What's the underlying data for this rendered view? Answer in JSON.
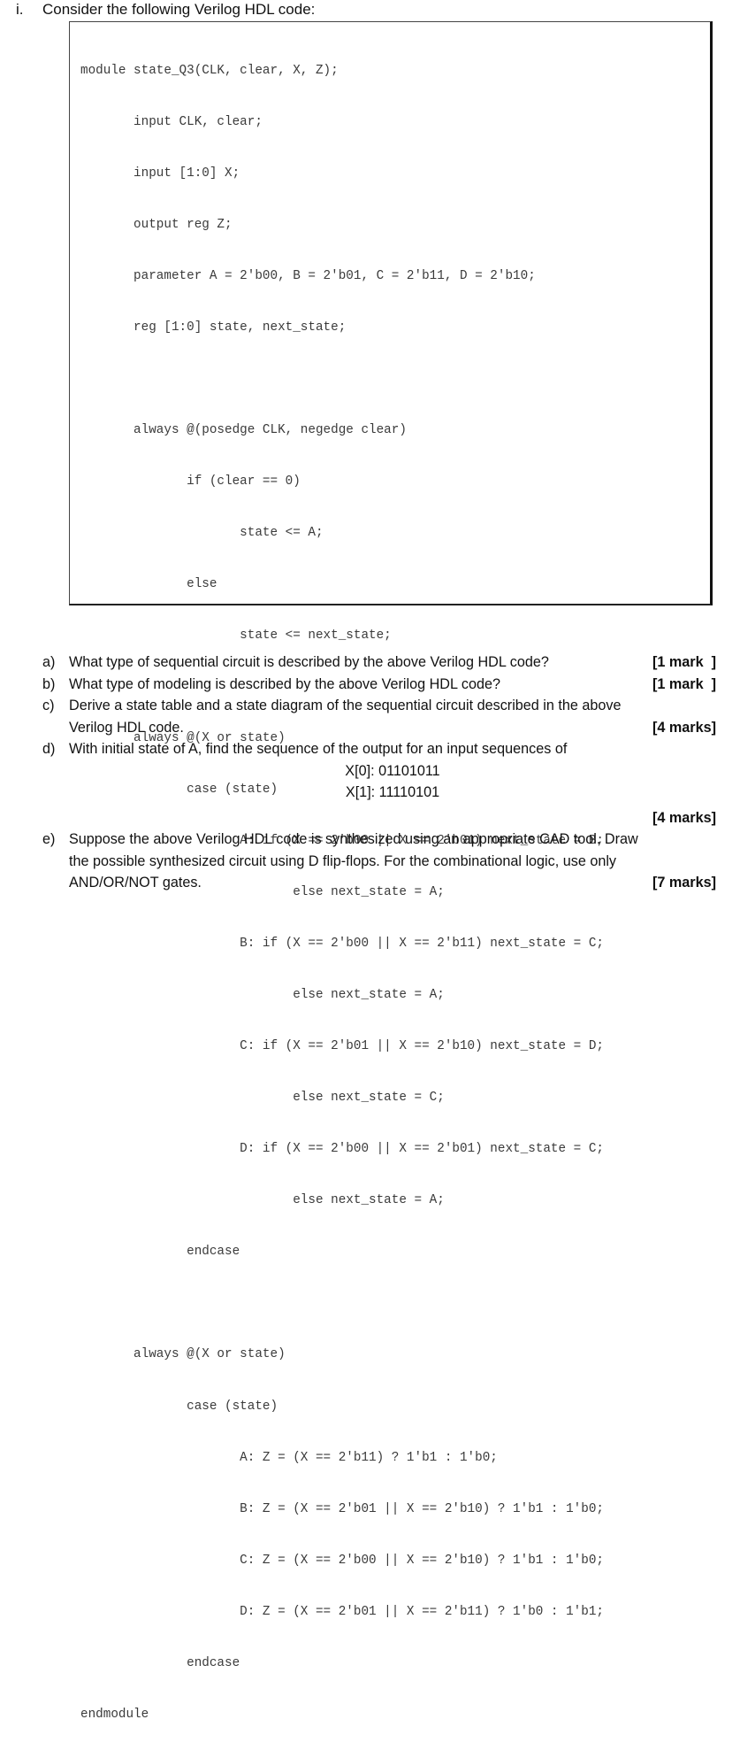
{
  "heading": {
    "number": "i.",
    "text": "Consider the following Verilog HDL code:"
  },
  "code": {
    "lines": [
      "module state_Q3(CLK, clear, X, Z);",
      "       input CLK, clear;",
      "       input [1:0] X;",
      "       output reg Z;",
      "       parameter A = 2'b00, B = 2'b01, C = 2'b11, D = 2'b10;",
      "       reg [1:0] state, next_state;",
      "",
      "       always @(posedge CLK, negedge clear)",
      "              if (clear == 0)",
      "                     state <= A;",
      "              else",
      "                     state <= next_state;",
      "",
      "       always @(X or state)",
      "              case (state)",
      "                     A: if (X == 2'b00 || X == 2'b01) next_state = B;",
      "                            else next_state = A;",
      "                     B: if (X == 2'b00 || X == 2'b11) next_state = C;",
      "                            else next_state = A;",
      "                     C: if (X == 2'b01 || X == 2'b10) next_state = D;",
      "                            else next_state = C;",
      "                     D: if (X == 2'b00 || X == 2'b01) next_state = C;",
      "                            else next_state = A;",
      "              endcase",
      "",
      "       always @(X or state)",
      "              case (state)",
      "                     A: Z = (X == 2'b11) ? 1'b1 : 1'b0;",
      "                     B: Z = (X == 2'b01 || X == 2'b10) ? 1'b1 : 1'b0;",
      "                     C: Z = (X == 2'b00 || X == 2'b10) ? 1'b1 : 1'b0;",
      "                     D: Z = (X == 2'b01 || X == 2'b11) ? 1'b0 : 1'b1;",
      "              endcase",
      "endmodule"
    ]
  },
  "questions": [
    {
      "label": "a)",
      "text": "What type of sequential circuit is described by the above Verilog HDL code?",
      "marks": "[1 mark  ]"
    },
    {
      "label": "b)",
      "text": "What type of modeling is described by the above Verilog HDL code?",
      "marks": "[1 mark  ]"
    },
    {
      "label": "c)",
      "text_line1": "Derive a state table and a state diagram of the sequential circuit described in the above",
      "text_line2": "Verilog HDL code.",
      "marks": "[4 marks]"
    },
    {
      "label": "d)",
      "text": "With initial state of A, find the sequence of the output for an input sequences of",
      "sequences": [
        "X[0]: 01101011",
        "X[1]: 11110101"
      ],
      "marks": "[4 marks]"
    },
    {
      "label": "e)",
      "text_line1": "Suppose the above Verilog HDL code is synthesized using an appropriate CAD tool. Draw",
      "text_line2": "the possible synthesized circuit using D flip-flops. For the combinational logic, use only",
      "text_line3": "AND/OR/NOT gates.",
      "marks": "[7 marks]"
    }
  ]
}
